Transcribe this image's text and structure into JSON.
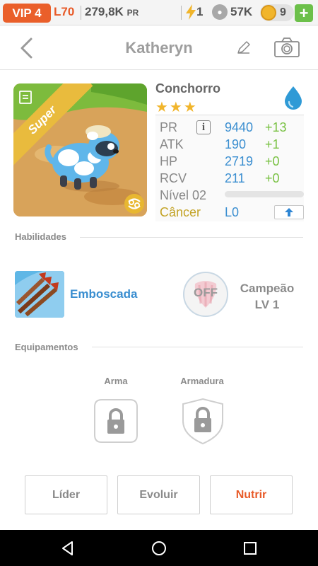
{
  "topbar": {
    "vip_label": "VIP 4",
    "level": "L70",
    "pr_total": "279,8K",
    "pr_unit": "PR",
    "energy": "1",
    "paws": "57K",
    "coins": "9",
    "add_label": "+"
  },
  "header": {
    "title": "Katheryn"
  },
  "pet": {
    "badge": "Super",
    "name": "Conchorro",
    "stars": "★★★",
    "stats": [
      {
        "label": "PR",
        "value": "9440",
        "bonus": "+13"
      },
      {
        "label": "ATK",
        "value": "190",
        "bonus": "+1"
      },
      {
        "label": "HP",
        "value": "2719",
        "bonus": "+0"
      },
      {
        "label": "RCV",
        "value": "211",
        "bonus": "+0"
      }
    ],
    "info_label": "i",
    "level_label": "Nível 02",
    "level_progress": 0,
    "sign": "Câncer",
    "lo": "L0"
  },
  "sections": {
    "abilities": "Habilidades",
    "equipment": "Equipamentos"
  },
  "ability": {
    "name": "Emboscada",
    "off_label": "OFF",
    "champion_line1": "Campeão",
    "champion_line2": "LV 1"
  },
  "equipment": {
    "weapon": "Arma",
    "armor": "Armadura"
  },
  "buttons": {
    "leader": "Líder",
    "evolve": "Evoluir",
    "feed": "Nutrir"
  },
  "colors": {
    "accent_orange": "#e85a28",
    "value_blue": "#3a8ed0",
    "bonus_green": "#78c142",
    "sign_gold": "#c3a326"
  }
}
